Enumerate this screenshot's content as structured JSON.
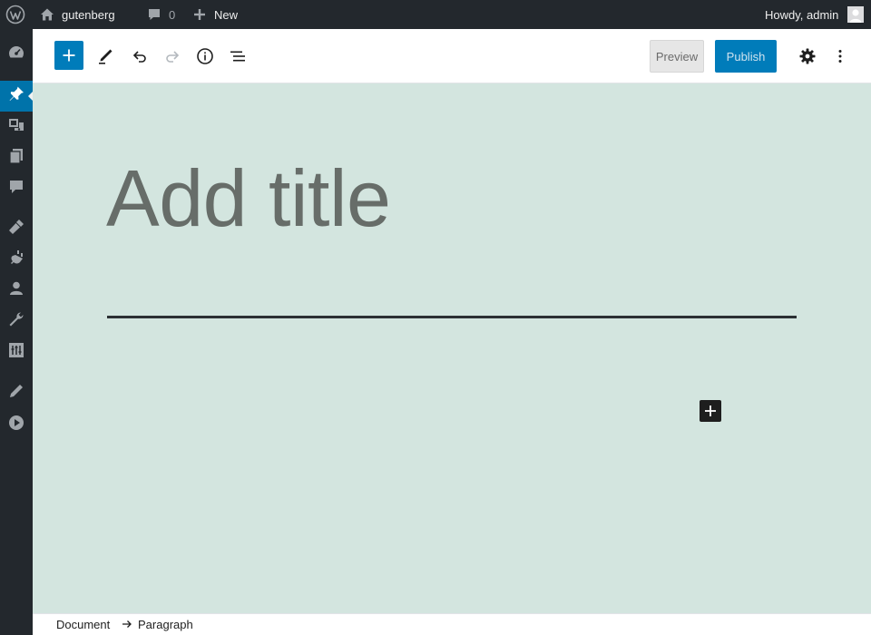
{
  "adminbar": {
    "site_name": "gutenberg",
    "comments_count": "0",
    "new_label": "New",
    "greeting": "Howdy, admin"
  },
  "sidebar": {
    "items": [
      {
        "icon": "dashboard-icon"
      },
      {
        "icon": "pin-icon",
        "active": true
      },
      {
        "icon": "media-icon"
      },
      {
        "icon": "pages-icon"
      },
      {
        "icon": "comments-icon"
      },
      {
        "icon": "appearance-icon"
      },
      {
        "icon": "plugins-icon"
      },
      {
        "icon": "users-icon"
      },
      {
        "icon": "tools-icon"
      },
      {
        "icon": "settings-icon"
      },
      {
        "icon": "pencil-icon"
      },
      {
        "icon": "play-icon"
      }
    ]
  },
  "toolbar": {
    "preview_label": "Preview",
    "publish_label": "Publish"
  },
  "editor": {
    "title_placeholder": "Add title"
  },
  "footer": {
    "breadcrumb": [
      "Document",
      "Paragraph"
    ]
  },
  "colors": {
    "admin_dark": "#23282d",
    "accent_blue": "#007cba",
    "active_blue": "#0073aa",
    "canvas_bg": "#d3e5df"
  }
}
